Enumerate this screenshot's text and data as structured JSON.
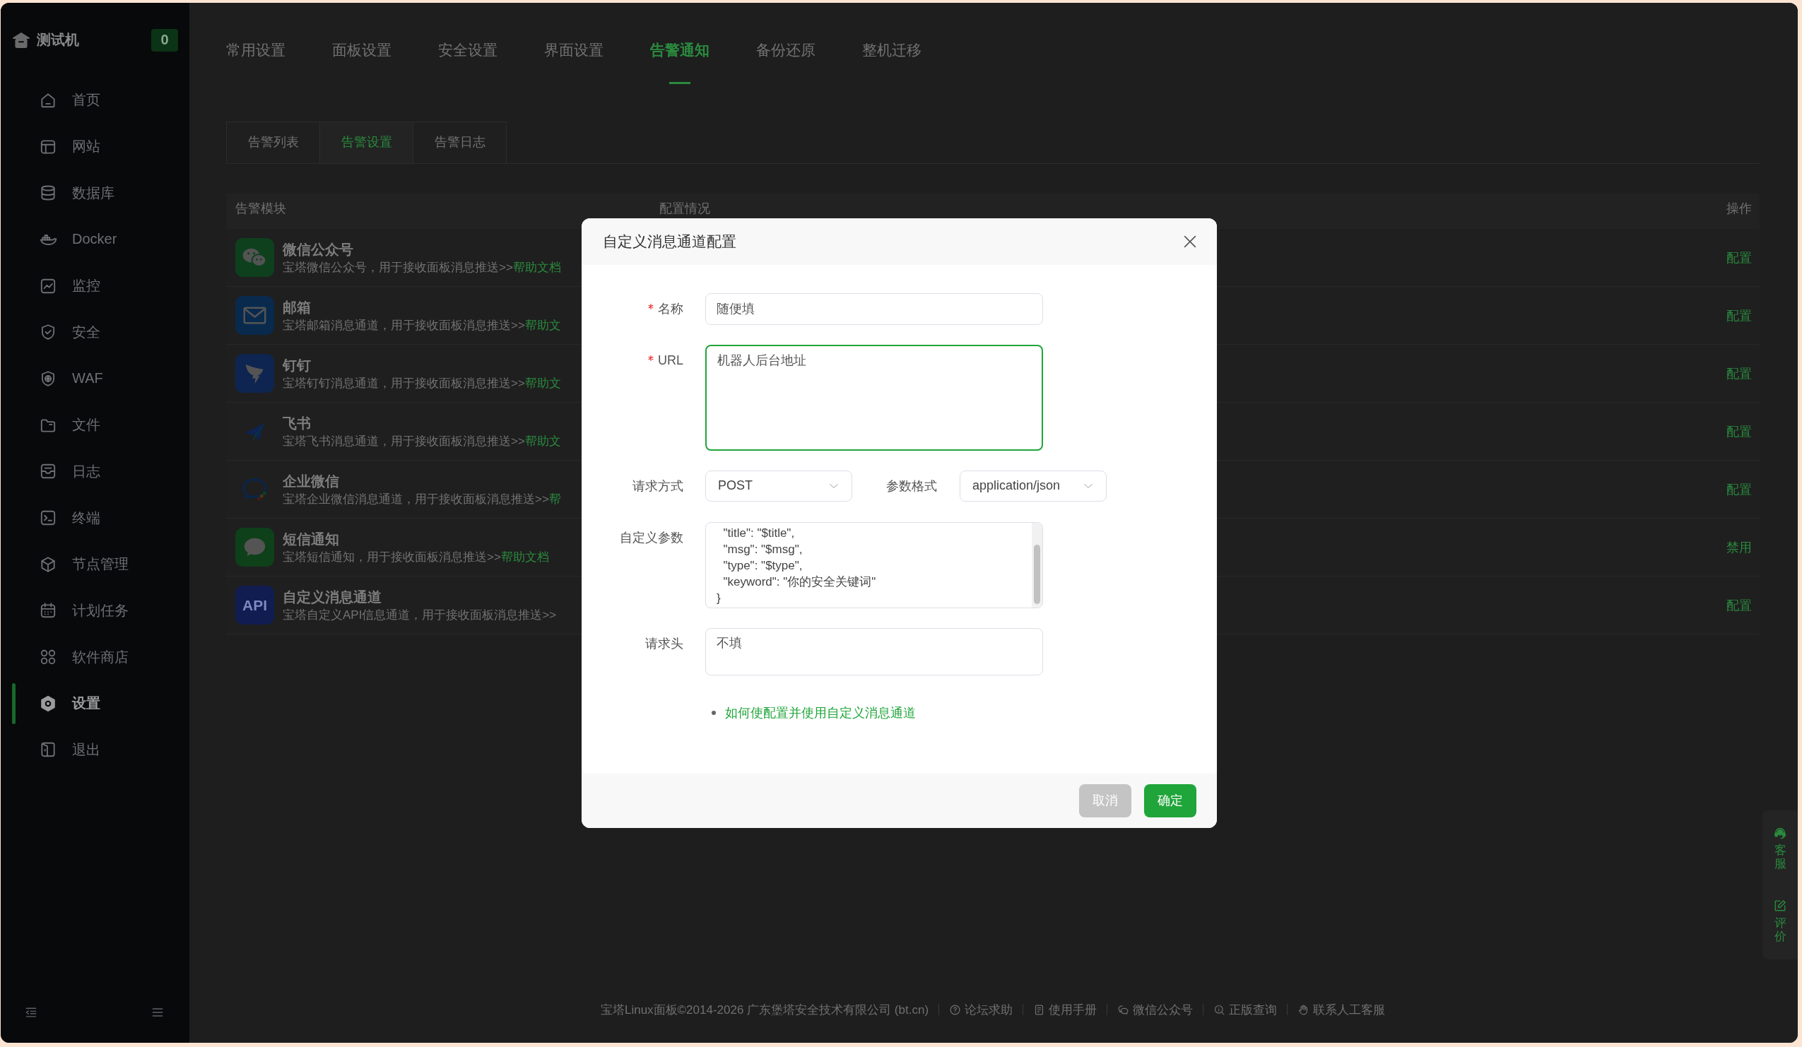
{
  "sidebar": {
    "title": "测试机",
    "badge": "0",
    "items": [
      {
        "label": "首页",
        "selected": false
      },
      {
        "label": "网站",
        "selected": false
      },
      {
        "label": "数据库",
        "selected": false
      },
      {
        "label": "Docker",
        "selected": false
      },
      {
        "label": "监控",
        "selected": false
      },
      {
        "label": "安全",
        "selected": false
      },
      {
        "label": "WAF",
        "selected": false
      },
      {
        "label": "文件",
        "selected": false
      },
      {
        "label": "日志",
        "selected": false
      },
      {
        "label": "终端",
        "selected": false
      },
      {
        "label": "节点管理",
        "selected": false
      },
      {
        "label": "计划任务",
        "selected": false
      },
      {
        "label": "软件商店",
        "selected": false
      },
      {
        "label": "设置",
        "selected": true
      },
      {
        "label": "退出",
        "selected": false
      }
    ]
  },
  "tabs": [
    {
      "label": "常用设置",
      "selected": false
    },
    {
      "label": "面板设置",
      "selected": false
    },
    {
      "label": "安全设置",
      "selected": false
    },
    {
      "label": "界面设置",
      "selected": false
    },
    {
      "label": "告警通知",
      "selected": true
    },
    {
      "label": "备份还原",
      "selected": false
    },
    {
      "label": "整机迁移",
      "selected": false
    }
  ],
  "subtabs": [
    {
      "label": "告警列表",
      "selected": false
    },
    {
      "label": "告警设置",
      "selected": true
    },
    {
      "label": "告警日志",
      "selected": false
    }
  ],
  "table": {
    "columns": [
      "告警模块",
      "配置情况",
      "操作"
    ],
    "rows": [
      {
        "title": "微信公众号",
        "description": "宝塔微信公众号，用于接收面板消息推送>>",
        "help": "帮助文档",
        "action": "配置"
      },
      {
        "title": "邮箱",
        "description": "宝塔邮箱消息通道，用于接收面板消息推送>>",
        "help": "帮助文",
        "action": "配置"
      },
      {
        "title": "钉钉",
        "description": "宝塔钉钉消息通道，用于接收面板消息推送>>",
        "help": "帮助文",
        "action": "配置"
      },
      {
        "title": "飞书",
        "description": "宝塔飞书消息通道，用于接收面板消息推送>>",
        "help": "帮助文",
        "action": "配置"
      },
      {
        "title": "企业微信",
        "description": "宝塔企业微信消息通道，用于接收面板消息推送>>",
        "help": "帮",
        "action": "配置"
      },
      {
        "title": "短信通知",
        "description": "宝塔短信通知，用于接收面板消息推送>>",
        "help": "帮助文档",
        "action": "禁用"
      },
      {
        "title": "自定义消息通道",
        "logo_text": "API",
        "description": "宝塔自定义API信息通道，用于接收面板消息推送>>",
        "action": "配置"
      }
    ]
  },
  "footer": {
    "copyright": "宝塔Linux面板©2014-2026 广东堡塔安全技术有限公司 (bt.cn)",
    "links": [
      "论坛求助",
      "使用手册",
      "微信公众号",
      "正版查询",
      "联系人工客服"
    ]
  },
  "float_panel": [
    "客服",
    "评价"
  ],
  "dialog": {
    "title": "自定义消息通道配置",
    "fields": [
      {
        "kind": "input",
        "label": "名称",
        "required": true,
        "focused": false,
        "value": "随便填"
      },
      {
        "kind": "textarea",
        "label": "URL",
        "required": true,
        "focused": true,
        "value": "机器人后台地址"
      },
      {
        "kind": "selects",
        "items": [
          {
            "label": "请求方式",
            "value": "POST"
          },
          {
            "label": "参数格式",
            "value": "application/json"
          }
        ]
      },
      {
        "kind": "code",
        "label": "自定义参数",
        "required": false,
        "focused": false,
        "lines": [
          "  \"title\": \"$title\",",
          "  \"msg\": \"$msg\",",
          "  \"type\": \"$type\",",
          "  \"keyword\": \"你的安全关键词\"",
          "}"
        ]
      },
      {
        "kind": "textarea",
        "label": "请求头",
        "required": false,
        "focused": false,
        "value": "不填"
      }
    ],
    "help_link": "如何使配置并使用自定义消息通道",
    "buttons": [
      {
        "label": "取消",
        "kind": "secondary"
      },
      {
        "label": "确定",
        "kind": "primary"
      }
    ]
  }
}
